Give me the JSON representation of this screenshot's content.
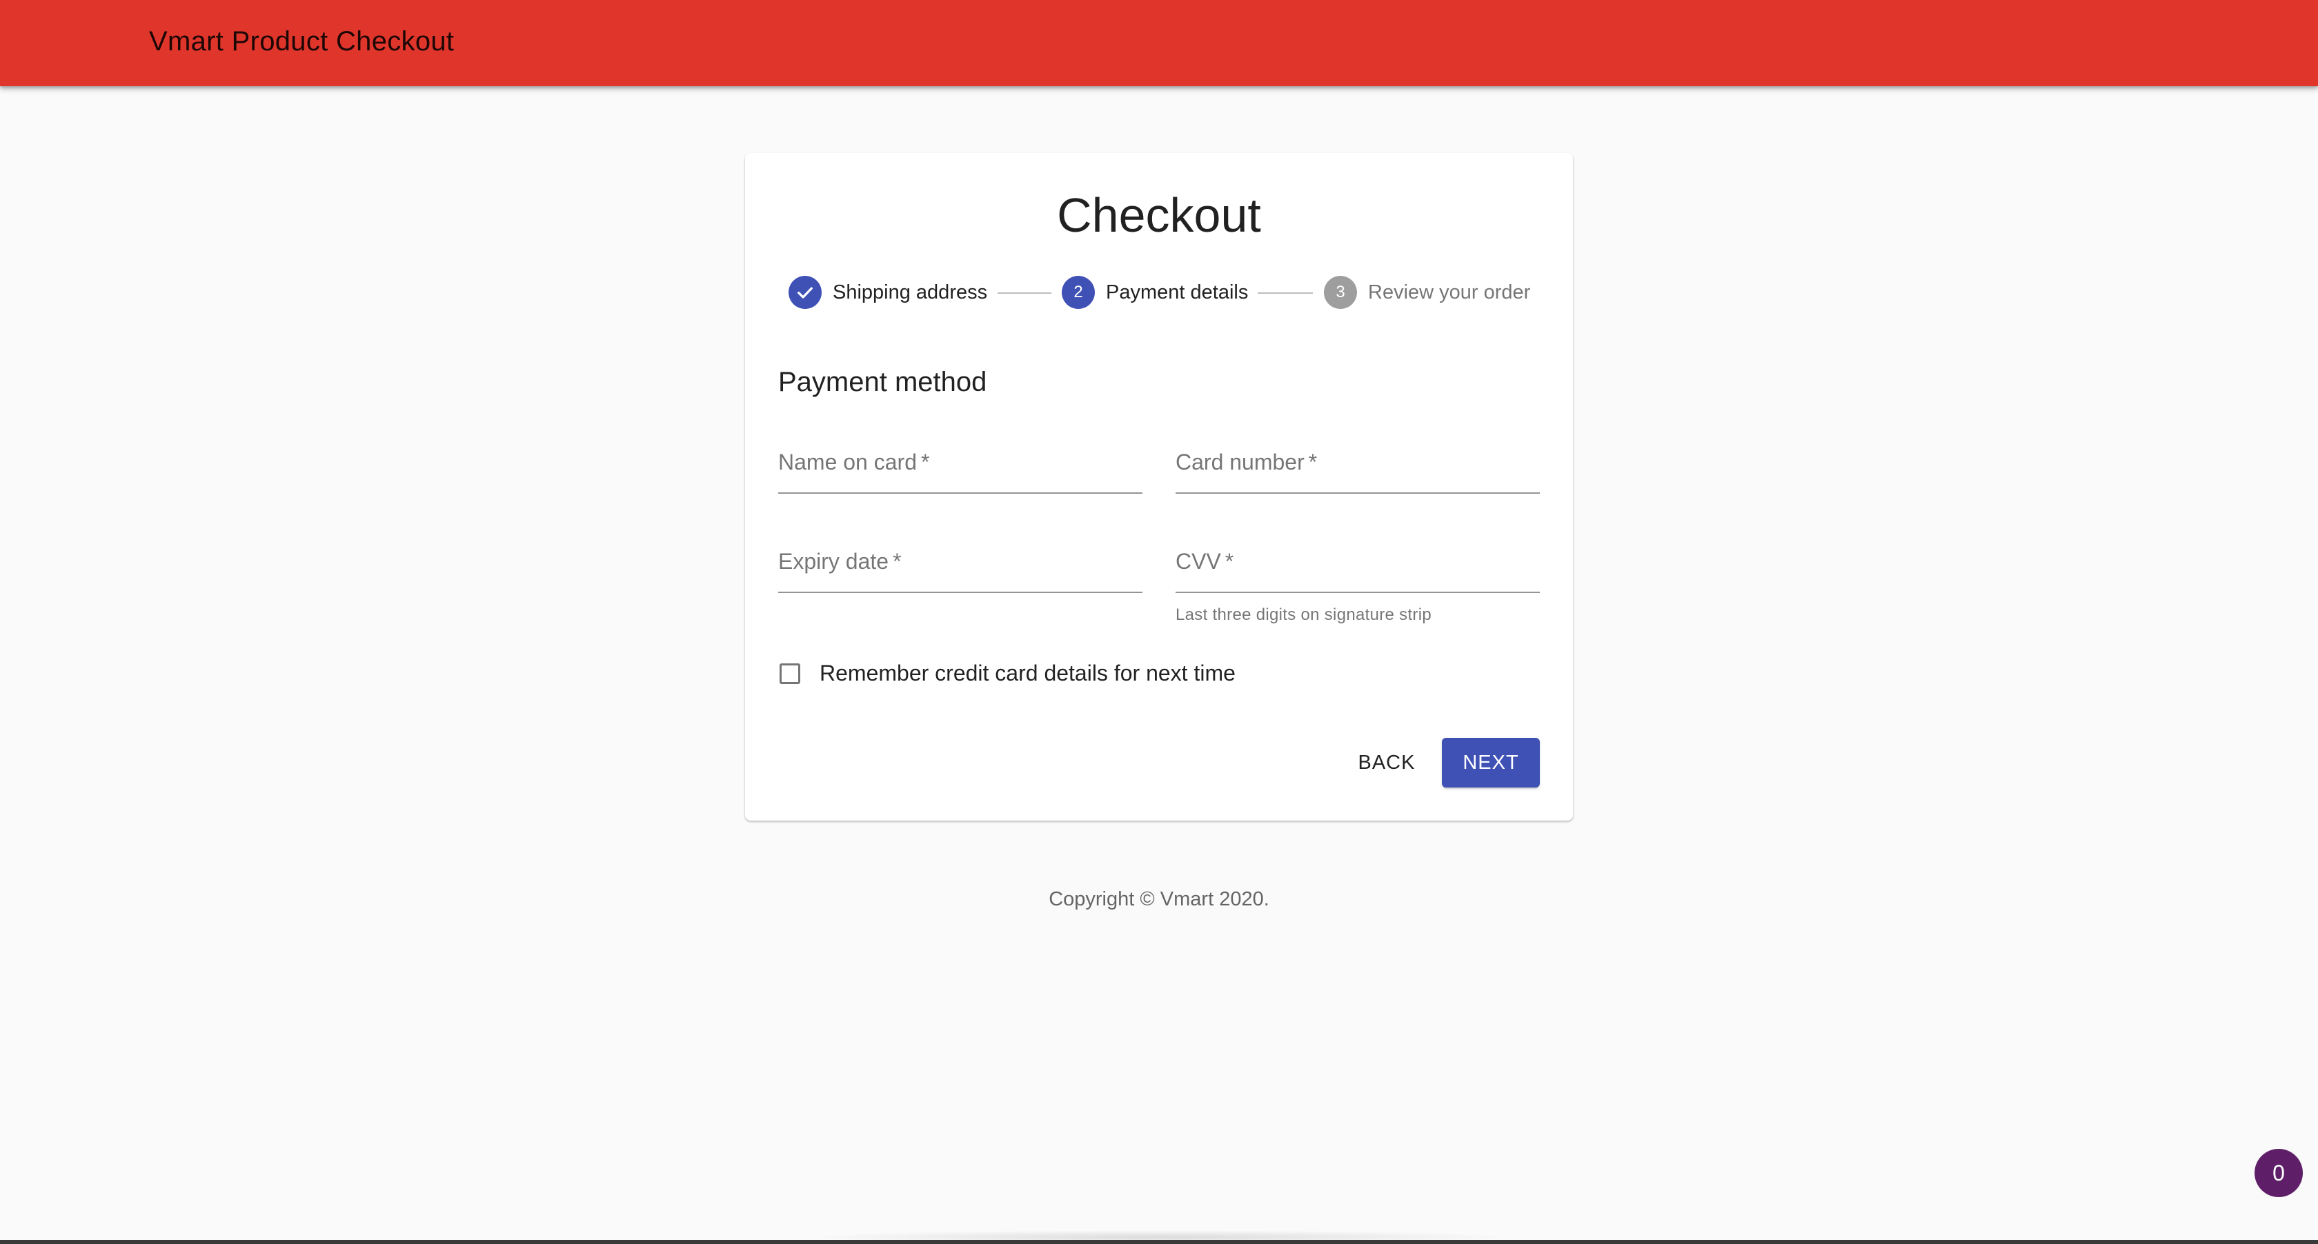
{
  "appbar": {
    "title": "Vmart Product Checkout"
  },
  "checkout": {
    "title": "Checkout",
    "steps": [
      {
        "label": "Shipping address",
        "state": "completed",
        "icon": "check-icon"
      },
      {
        "label": "Payment details",
        "state": "active",
        "number": "2"
      },
      {
        "label": "Review your order",
        "state": "pending",
        "number": "3"
      }
    ],
    "section_title": "Payment method",
    "fields": {
      "name_on_card": {
        "label": "Name on card",
        "required_mark": "*",
        "value": ""
      },
      "card_number": {
        "label": "Card number",
        "required_mark": "*",
        "value": ""
      },
      "expiry_date": {
        "label": "Expiry date",
        "required_mark": "*",
        "value": ""
      },
      "cvv": {
        "label": "CVV",
        "required_mark": "*",
        "value": "",
        "helper": "Last three digits on signature strip"
      }
    },
    "remember_checkbox": {
      "label": "Remember credit card details for next time",
      "checked": false
    },
    "buttons": {
      "back": "BACK",
      "next": "NEXT"
    }
  },
  "footer": {
    "copyright": "Copyright © Vmart 2020."
  },
  "badge": {
    "count": "0"
  },
  "colors": {
    "appbar": "#e0352b",
    "primary": "#3f51b5",
    "pending_step": "#9e9e9e",
    "badge": "#5e1f68",
    "page_background": "#fafafa"
  }
}
